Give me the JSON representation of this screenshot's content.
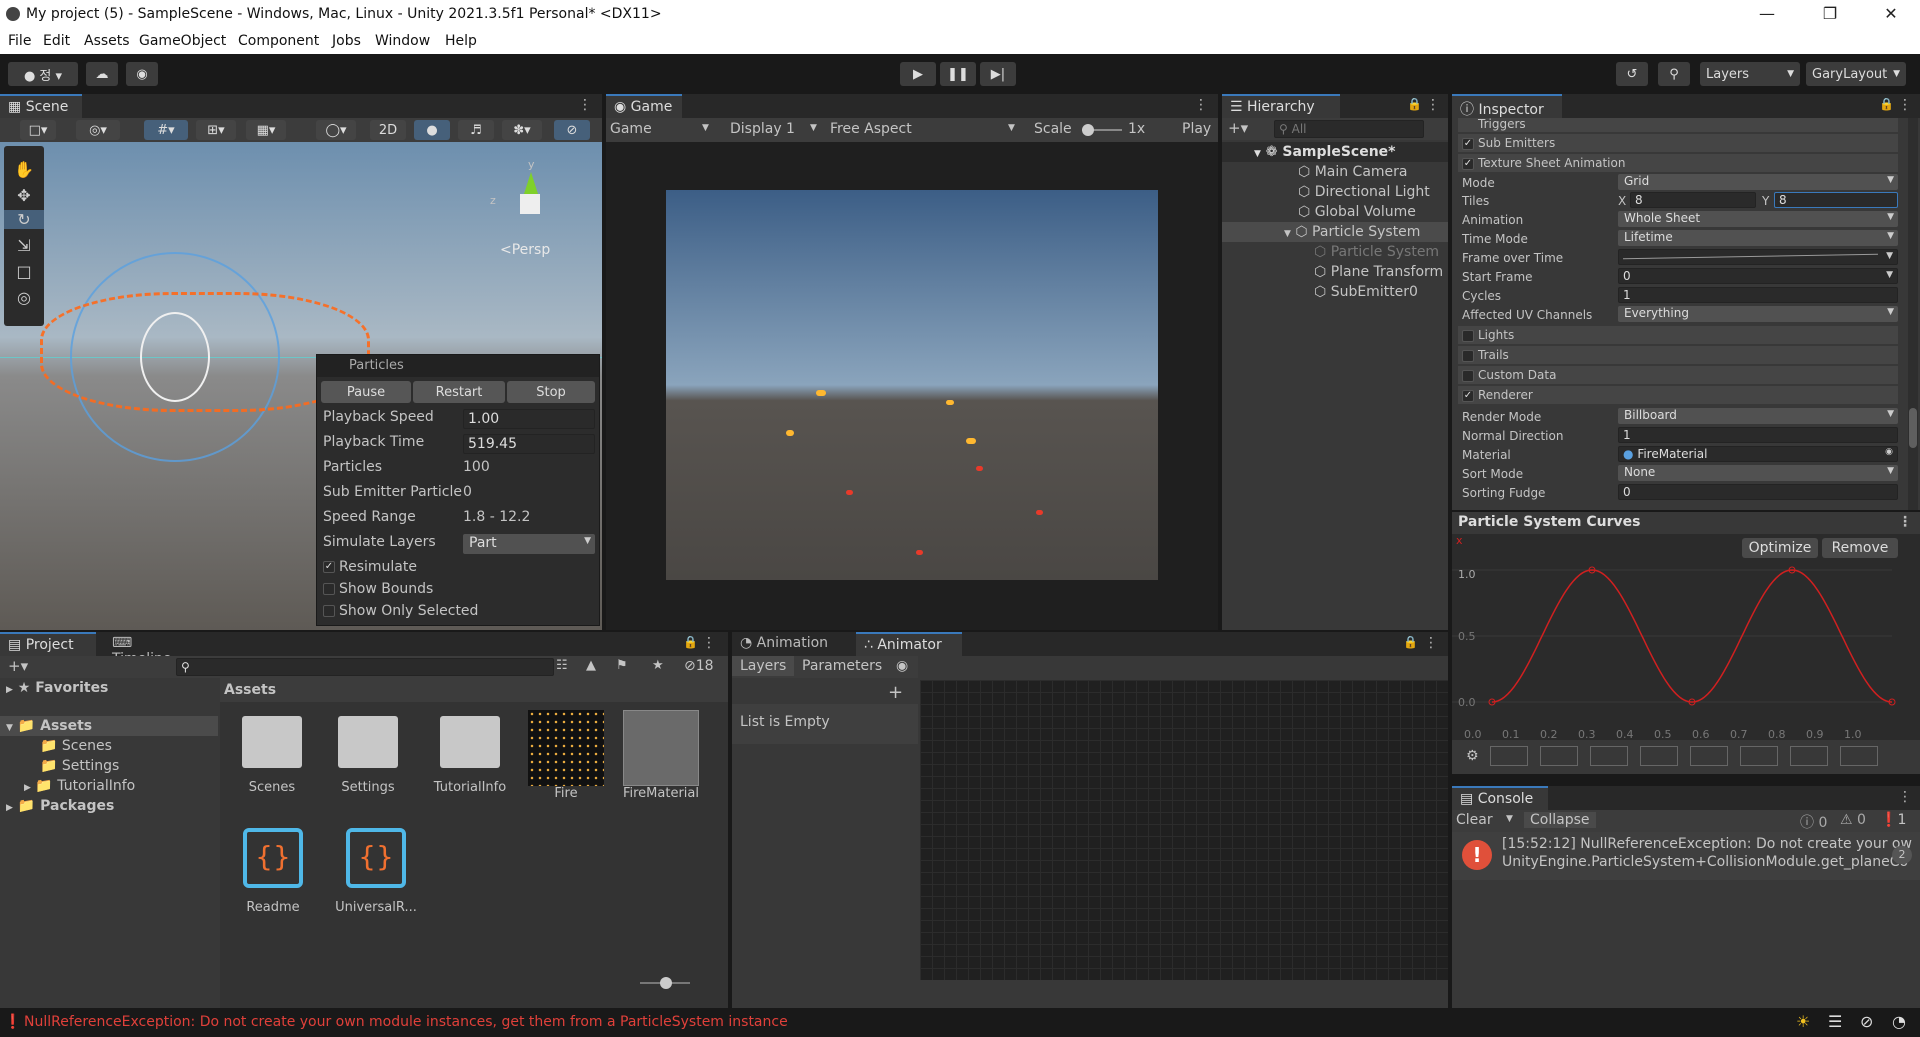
{
  "window": {
    "title": "My project (5) - SampleScene - Windows, Mac, Linux - Unity 2021.3.5f1 Personal* <DX11>"
  },
  "menu": [
    "File",
    "Edit",
    "Assets",
    "GameObject",
    "Component",
    "Jobs",
    "Window",
    "Help"
  ],
  "toolbar": {
    "layers_label": "Layers",
    "layout_label": "GaryLayout"
  },
  "scene": {
    "tab": "Scene",
    "mode_2d": "2D",
    "persp": "<Persp",
    "gizmo_y": "y",
    "gizmo_z": "z"
  },
  "particles": {
    "title": "Particles",
    "pause": "Pause",
    "restart": "Restart",
    "stop": "Stop",
    "rows": [
      {
        "label": "Playback Speed",
        "value": "1.00"
      },
      {
        "label": "Playback Time",
        "value": "519.45"
      },
      {
        "label": "Particles",
        "value": "100"
      },
      {
        "label": "Sub Emitter Particle",
        "value": "0"
      },
      {
        "label": "Speed Range",
        "value": "1.8 - 12.2"
      }
    ],
    "simulate_label": "Simulate Layers",
    "simulate_value": "Part",
    "resimulate": "Resimulate",
    "show_bounds": "Show Bounds",
    "show_only_selected": "Show Only Selected"
  },
  "game": {
    "tab": "Game",
    "mode": "Game",
    "display": "Display 1",
    "aspect": "Free Aspect",
    "scale_label": "Scale",
    "scale_value": "1x",
    "play_label": "Play"
  },
  "hierarchy": {
    "tab": "Hierarchy",
    "search_placeholder": "All",
    "items": [
      {
        "label": "SampleScene*",
        "depth": 0
      },
      {
        "label": "Main Camera",
        "depth": 1
      },
      {
        "label": "Directional Light",
        "depth": 1
      },
      {
        "label": "Global Volume",
        "depth": 1
      },
      {
        "label": "Particle System",
        "depth": 1
      },
      {
        "label": "Particle System",
        "depth": 2
      },
      {
        "label": "Plane Transform",
        "depth": 2
      },
      {
        "label": "SubEmitter0",
        "depth": 2
      }
    ]
  },
  "inspector": {
    "tab": "Inspector",
    "modules": {
      "triggers": "Triggers",
      "sub_emitters": "Sub Emitters",
      "texture_sheet": "Texture Sheet Animation",
      "lights": "Lights",
      "trails": "Trails",
      "custom_data": "Custom Data",
      "renderer": "Renderer"
    },
    "tsa_rows": [
      {
        "label": "Mode",
        "value": "Grid",
        "dropdown": true
      },
      {
        "label": "Animation",
        "value": "Whole Sheet",
        "dropdown": true
      },
      {
        "label": "Time Mode",
        "value": "Lifetime",
        "dropdown": true
      },
      {
        "label": "Frame over Time",
        "value": "",
        "dropdown": true
      },
      {
        "label": "Start Frame",
        "value": "0",
        "dropdown": true
      },
      {
        "label": "Cycles",
        "value": "1",
        "dropdown": false
      },
      {
        "label": "Affected UV Channels",
        "value": "Everything",
        "dropdown": true
      }
    ],
    "tiles_label": "Tiles",
    "tiles_x_label": "X",
    "tiles_x": "8",
    "tiles_y_label": "Y",
    "tiles_y": "8",
    "renderer_rows": [
      {
        "label": "Render Mode",
        "value": "Billboard",
        "dropdown": true
      },
      {
        "label": "Normal Direction",
        "value": "1",
        "dropdown": false
      },
      {
        "label": "Material",
        "value": "FireMaterial",
        "dropdown": false
      },
      {
        "label": "Sort Mode",
        "value": "None",
        "dropdown": true
      },
      {
        "label": "Sorting Fudge",
        "value": "0",
        "dropdown": false
      }
    ]
  },
  "curves": {
    "title": "Particle System Curves",
    "optimize": "Optimize",
    "remove": "Remove",
    "x_marker": "x",
    "y_ticks": [
      "1.0",
      "0.5",
      "0.0"
    ],
    "x_ticks": [
      "0.0",
      "0.1",
      "0.2",
      "0.3",
      "0.4",
      "0.5",
      "0.6",
      "0.7",
      "0.8",
      "0.9",
      "1.0"
    ],
    "color": "#d02020"
  },
  "console": {
    "tab": "Console",
    "clear": "Clear",
    "collapse": "Collapse",
    "info_count": "0",
    "warn_count": "0",
    "error_count": "1",
    "message_line1": "[15:52:12] NullReferenceException: Do not create your own",
    "message_line2": "UnityEngine.ParticleSystem+CollisionModule.get_planeCo",
    "message_count": "2"
  },
  "project": {
    "tab": "Project",
    "timeline_tab": "Timeline",
    "favorites": "Favorites",
    "assets": "Assets",
    "folders": [
      "Scenes",
      "Settings",
      "TutorialInfo"
    ],
    "packages": "Packages",
    "hidden_count": "18",
    "assets_header": "Assets",
    "items": [
      {
        "name": "Scenes",
        "kind": "folder"
      },
      {
        "name": "Settings",
        "kind": "folder"
      },
      {
        "name": "TutorialInfo",
        "kind": "folder"
      },
      {
        "name": "Fire",
        "kind": "texture"
      },
      {
        "name": "FireMaterial",
        "kind": "material"
      },
      {
        "name": "Readme",
        "kind": "script"
      },
      {
        "name": "UniversalR...",
        "kind": "script"
      }
    ]
  },
  "animator": {
    "animation_tab": "Animation",
    "animator_tab": "Animator",
    "layers_tab": "Layers",
    "parameters_tab": "Parameters",
    "empty_text": "List is Empty"
  },
  "status": {
    "message": "NullReferenceException: Do not create your own module instances, get them from a ParticleSystem instance",
    "color": "#e0403a"
  }
}
